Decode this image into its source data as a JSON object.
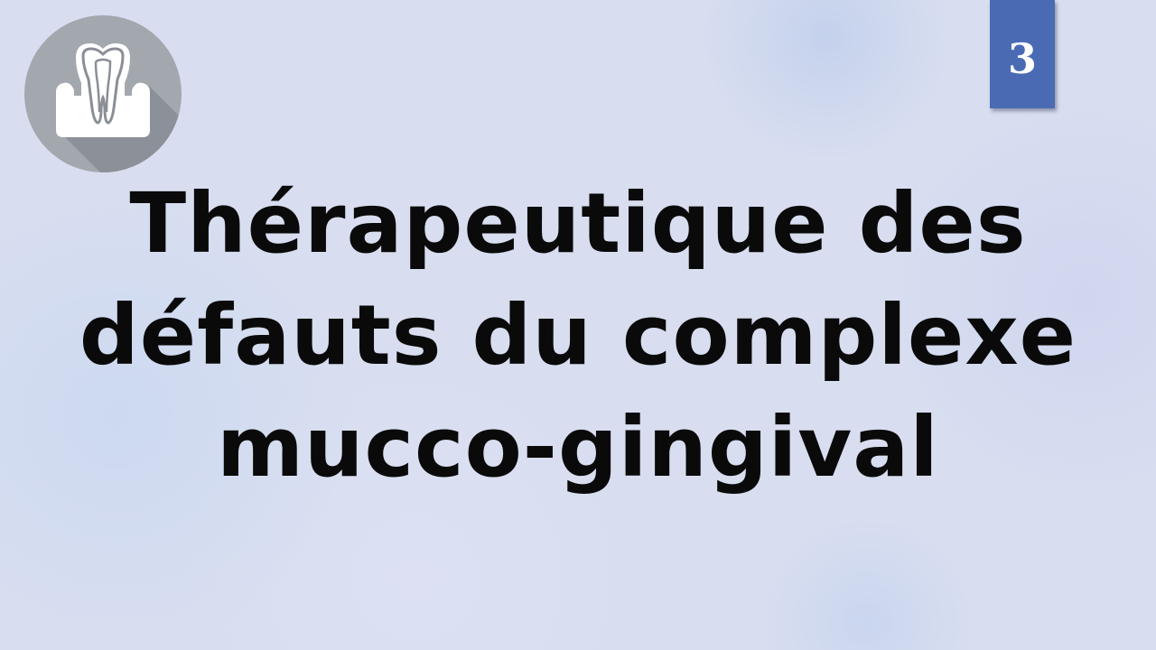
{
  "slide": {
    "page_number": "3",
    "title_lines": [
      "Thérapeutique des",
      "défauts du complexe",
      "mucco-gingival"
    ]
  },
  "logo": {
    "icon": "tooth-icon"
  },
  "colors": {
    "background": "#d8def0",
    "badge": "#4a6bb4",
    "logo_circle": "#a3a7ae",
    "title_text": "#0a0a0a"
  }
}
